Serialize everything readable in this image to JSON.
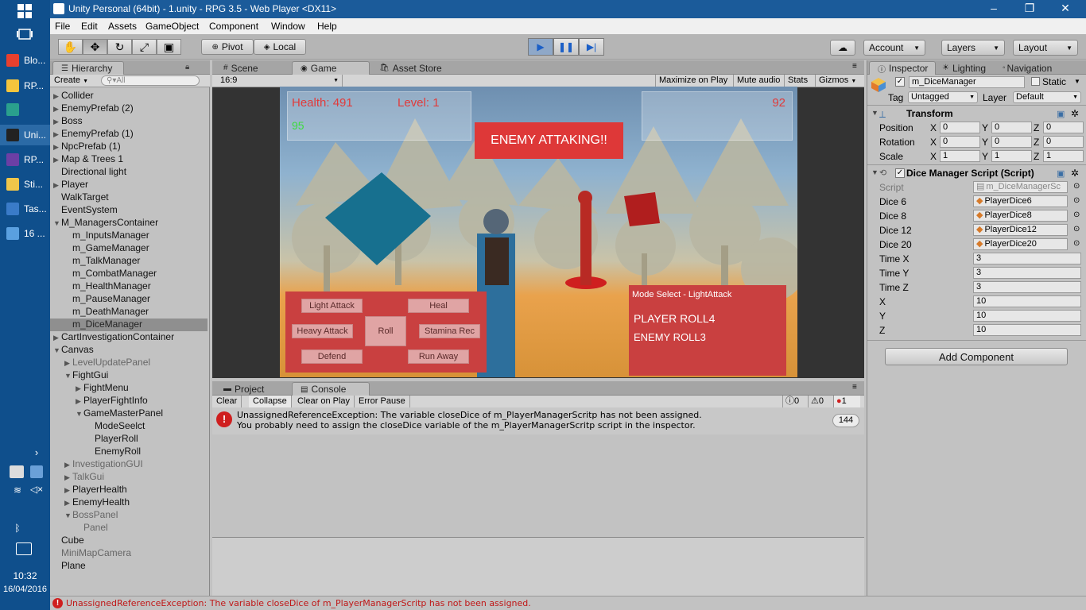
{
  "taskbar": {
    "items": [
      {
        "label": "Blo..."
      },
      {
        "label": "RP..."
      },
      {
        "label": ""
      },
      {
        "label": "Uni..."
      },
      {
        "label": "RP..."
      },
      {
        "label": "Sti..."
      },
      {
        "label": "Tas..."
      },
      {
        "label": "16 ..."
      }
    ],
    "time": "10:32",
    "date": "16/04/2016"
  },
  "window": {
    "title": "Unity Personal (64bit) - 1.unity - RPG 3.5 - Web Player <DX11>"
  },
  "menu": [
    "File",
    "Edit",
    "Assets",
    "GameObject",
    "Component",
    "Window",
    "Help"
  ],
  "toolbar": {
    "pivot": "Pivot",
    "local": "Local",
    "account": "Account",
    "layers": "Layers",
    "layout": "Layout"
  },
  "hierarchy": {
    "tab": "Hierarchy",
    "create": "Create",
    "search_placeholder": "All",
    "rows": [
      {
        "label": "Collider",
        "indent": 0,
        "arrow": "▶",
        "style": ""
      },
      {
        "label": "EnemyPrefab (2)",
        "indent": 0,
        "arrow": "▶",
        "style": ""
      },
      {
        "label": "Boss",
        "indent": 0,
        "arrow": "▶",
        "style": ""
      },
      {
        "label": "EnemyPrefab (1)",
        "indent": 0,
        "arrow": "▶",
        "style": ""
      },
      {
        "label": "NpcPrefab (1)",
        "indent": 0,
        "arrow": "▶",
        "style": ""
      },
      {
        "label": "Map & Trees 1",
        "indent": 0,
        "arrow": "▶",
        "style": ""
      },
      {
        "label": "Directional light",
        "indent": 0,
        "arrow": "",
        "style": ""
      },
      {
        "label": "Player",
        "indent": 0,
        "arrow": "▶",
        "style": ""
      },
      {
        "label": "WalkTarget",
        "indent": 0,
        "arrow": "",
        "style": ""
      },
      {
        "label": "EventSystem",
        "indent": 0,
        "arrow": "",
        "style": ""
      },
      {
        "label": "M_ManagersContainer",
        "indent": 0,
        "arrow": "▼",
        "style": ""
      },
      {
        "label": "m_InputsManager",
        "indent": 1,
        "arrow": "",
        "style": ""
      },
      {
        "label": "m_GameManager",
        "indent": 1,
        "arrow": "",
        "style": ""
      },
      {
        "label": "m_TalkManager",
        "indent": 1,
        "arrow": "",
        "style": ""
      },
      {
        "label": "m_CombatManager",
        "indent": 1,
        "arrow": "",
        "style": ""
      },
      {
        "label": "m_HealthManager",
        "indent": 1,
        "arrow": "",
        "style": ""
      },
      {
        "label": "m_PauseManager",
        "indent": 1,
        "arrow": "",
        "style": ""
      },
      {
        "label": "m_DeathManager",
        "indent": 1,
        "arrow": "",
        "style": ""
      },
      {
        "label": "m_DiceManager",
        "indent": 1,
        "arrow": "",
        "style": "sel"
      },
      {
        "label": "CartInvestigationContainer",
        "indent": 0,
        "arrow": "▶",
        "style": ""
      },
      {
        "label": "Canvas",
        "indent": 0,
        "arrow": "▼",
        "style": ""
      },
      {
        "label": "LevelUpdatePanel",
        "indent": 1,
        "arrow": "▶",
        "style": "grey"
      },
      {
        "label": "FightGui",
        "indent": 1,
        "arrow": "▼",
        "style": ""
      },
      {
        "label": "FightMenu",
        "indent": 2,
        "arrow": "▶",
        "style": ""
      },
      {
        "label": "PlayerFightInfo",
        "indent": 2,
        "arrow": "▶",
        "style": ""
      },
      {
        "label": "GameMasterPanel",
        "indent": 2,
        "arrow": "▼",
        "style": ""
      },
      {
        "label": "ModeSeelct",
        "indent": 3,
        "arrow": "",
        "style": ""
      },
      {
        "label": "PlayerRoll",
        "indent": 3,
        "arrow": "",
        "style": ""
      },
      {
        "label": "EnemyRoll",
        "indent": 3,
        "arrow": "",
        "style": ""
      },
      {
        "label": "InvestigationGUI",
        "indent": 1,
        "arrow": "▶",
        "style": "grey"
      },
      {
        "label": "TalkGui",
        "indent": 1,
        "arrow": "▶",
        "style": "grey"
      },
      {
        "label": "PlayerHealth",
        "indent": 1,
        "arrow": "▶",
        "style": ""
      },
      {
        "label": "EnemyHealth",
        "indent": 1,
        "arrow": "▶",
        "style": ""
      },
      {
        "label": "BossPanel",
        "indent": 1,
        "arrow": "▼",
        "style": "grey"
      },
      {
        "label": "Panel",
        "indent": 2,
        "arrow": "",
        "style": "grey"
      },
      {
        "label": "Cube",
        "indent": 0,
        "arrow": "",
        "style": ""
      },
      {
        "label": "MiniMapCamera",
        "indent": 0,
        "arrow": "",
        "style": "grey"
      },
      {
        "label": "Plane",
        "indent": 0,
        "arrow": "",
        "style": ""
      }
    ]
  },
  "center_tabs": {
    "scene": "Scene",
    "game": "Game",
    "asset_store": "Asset Store",
    "aspect": "16:9",
    "maximize": "Maximize on Play",
    "mute": "Mute audio",
    "stats": "Stats",
    "gizmos": "Gizmos"
  },
  "game": {
    "health": "Health: 491",
    "level": "Level: 1",
    "stamina": "95",
    "enemy_health": "92",
    "banner": "ENEMY ATTAKING!!",
    "buttons": {
      "light_attack": "Light Attack",
      "heal": "Heal",
      "heavy_attack": "Heavy Attack",
      "roll": "Roll",
      "stamina_rec": "Stamina Rec",
      "defend": "Defend",
      "run_away": "Run Away"
    },
    "mode_select": "Mode Select - LightAttack",
    "player_roll": "PLAYER ROLL4",
    "enemy_roll": "ENEMY ROLL3"
  },
  "bottom": {
    "project_tab": "Project",
    "console_tab": "Console",
    "clear": "Clear",
    "collapse": "Collapse",
    "clear_on_play": "Clear on Play",
    "error_pause": "Error Pause",
    "info_count": "0",
    "warn_count": "0",
    "error_count": "1",
    "msg_line1": "UnassignedReferenceException: The variable closeDice of m_PlayerManagerScritp has not been assigned.",
    "msg_line2": "You probably need to assign the closeDice variable of the m_PlayerManagerScritp script in the inspector.",
    "msg_count": "144"
  },
  "inspector": {
    "tab": "Inspector",
    "lighting": "Lighting",
    "navigation": "Navigation",
    "object_name": "m_DiceManager",
    "static": "Static",
    "tag_label": "Tag",
    "tag": "Untagged",
    "layer_label": "Layer",
    "layer": "Default",
    "transform": "Transform",
    "position": {
      "label": "Position",
      "x": "0",
      "y": "0",
      "z": "0"
    },
    "rotation": {
      "label": "Rotation",
      "x": "0",
      "y": "0",
      "z": "0"
    },
    "scale": {
      "label": "Scale",
      "x": "1",
      "y": "1",
      "z": "1"
    },
    "script_component": "Dice Manager Script (Script)",
    "fields": [
      {
        "label": "Script",
        "value": "m_DiceManagerSc",
        "kind": "obj",
        "grey": true
      },
      {
        "label": "Dice 6",
        "value": "PlayerDice6",
        "kind": "obj",
        "grey": false
      },
      {
        "label": "Dice 8",
        "value": "PlayerDice8",
        "kind": "obj",
        "grey": false
      },
      {
        "label": "Dice 12",
        "value": "PlayerDice12",
        "kind": "obj",
        "grey": false
      },
      {
        "label": "Dice 20",
        "value": "PlayerDice20",
        "kind": "obj",
        "grey": false
      },
      {
        "label": "Time X",
        "value": "3",
        "kind": "num",
        "grey": false
      },
      {
        "label": "Time Y",
        "value": "3",
        "kind": "num",
        "grey": false
      },
      {
        "label": "Time Z",
        "value": "3",
        "kind": "num",
        "grey": false
      },
      {
        "label": "X",
        "value": "10",
        "kind": "num",
        "grey": false
      },
      {
        "label": "Y",
        "value": "10",
        "kind": "num",
        "grey": false
      },
      {
        "label": "Z",
        "value": "10",
        "kind": "num",
        "grey": false
      }
    ],
    "add_component": "Add Component"
  },
  "status": {
    "message": "UnassignedReferenceException: The variable closeDice of m_PlayerManagerScritp has not been assigned."
  },
  "colors": {
    "accent_red": "#c94040",
    "play_blue": "#1b5fc7",
    "taskbar": "#0f4f8c"
  }
}
